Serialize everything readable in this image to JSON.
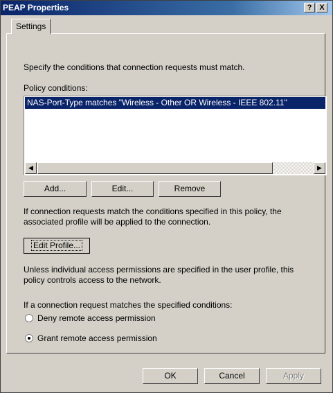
{
  "window": {
    "title": "PEAP Properties",
    "help_glyph": "?",
    "close_glyph": "X"
  },
  "tabs": [
    {
      "label": "Settings"
    }
  ],
  "intro_text": "Specify the conditions that connection requests must match.",
  "policy_conditions": {
    "label": "Policy conditions:",
    "items": [
      "NAS-Port-Type matches \"Wireless - Other OR Wireless - IEEE 802.11\""
    ],
    "scroll_left_glyph": "◀",
    "scroll_right_glyph": "▶"
  },
  "condition_buttons": {
    "add": "Add...",
    "edit": "Edit...",
    "remove": "Remove"
  },
  "profile_note_line1": "If connection requests match the conditions specified in this policy, the",
  "profile_note_line2": "associated profile will be applied to the connection.",
  "edit_profile_label": "Edit Profile...",
  "permission_note_line1": "Unless individual access permissions are specified in the user profile, this",
  "permission_note_line2": "policy controls access to the network.",
  "match_prompt": "If a connection request matches the specified conditions:",
  "options": [
    {
      "label": "Deny remote access permission",
      "checked": false
    },
    {
      "label": "Grant remote access permission",
      "checked": true
    }
  ],
  "footer": {
    "ok": "OK",
    "cancel": "Cancel",
    "apply": "Apply"
  },
  "icons": {
    "help": "help-icon",
    "close": "close-icon"
  }
}
